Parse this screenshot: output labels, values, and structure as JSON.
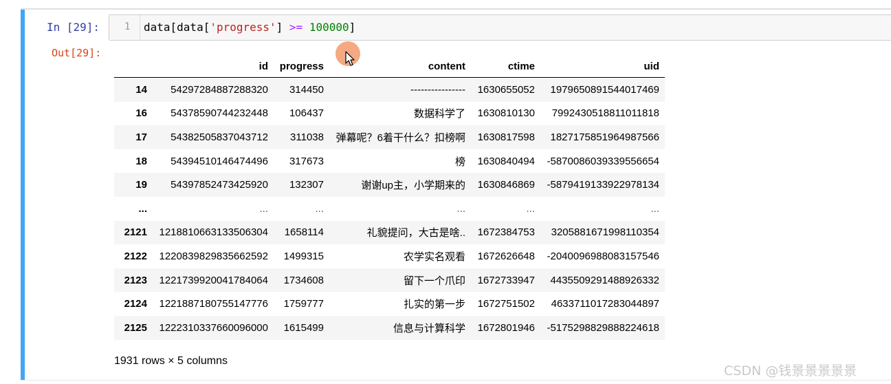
{
  "prompt_in": "In [29]:",
  "prompt_out": "Out[29]:",
  "code": {
    "line_number": "1",
    "t1": "data[data[",
    "t2": "'progress'",
    "t3": "] ",
    "t4": ">=",
    "t5": " ",
    "t6": "100000",
    "t7": "]"
  },
  "table": {
    "columns": [
      "",
      "id",
      "progress",
      "content",
      "ctime",
      "uid"
    ],
    "rows": [
      [
        "14",
        "54297284887288320",
        "314450",
        "----------------",
        "1630655052",
        "1979650891544017469"
      ],
      [
        "16",
        "54378590744232448",
        "106437",
        "数据科学了",
        "1630810130",
        "7992430518811011818"
      ],
      [
        "17",
        "54382505837043712",
        "311038",
        "弹幕呢？6着干什么？扣榜啊",
        "1630817598",
        "1827175851964987566"
      ],
      [
        "18",
        "54394510146474496",
        "317673",
        "榜",
        "1630840494",
        "-5870086039339556654"
      ],
      [
        "19",
        "54397852473425920",
        "132307",
        "谢谢up主，小学期来的",
        "1630846869",
        "-5879419133922978134"
      ],
      [
        "...",
        "...",
        "...",
        "...",
        "...",
        "..."
      ],
      [
        "2121",
        "1218810663133506304",
        "1658114",
        "礼貌提问，大古是啥..",
        "1672384753",
        "3205881671998110354"
      ],
      [
        "2122",
        "1220839829835662592",
        "1499315",
        "农学实名观看",
        "1672626648",
        "-2040096988083157546"
      ],
      [
        "2123",
        "1221739920041784064",
        "1734608",
        "留下一个爪印",
        "1672733947",
        "4435509291488926332"
      ],
      [
        "2124",
        "1221887180755147776",
        "1759777",
        "扎实的第一步",
        "1672751502",
        "4633711017283044897"
      ],
      [
        "2125",
        "1222310337660096000",
        "1615499",
        "信息与计算科学",
        "1672801946",
        "-5175298829888224618"
      ]
    ]
  },
  "shape_note": "1931 rows × 5 columns",
  "watermark": "CSDN @钱景景景景景",
  "colors": {
    "cell_bar": "#42a5f5",
    "prompt_in": "#303f9f",
    "prompt_out": "#d84315",
    "string": "#ba2121",
    "operator": "#aa22ff",
    "number": "#008000"
  }
}
